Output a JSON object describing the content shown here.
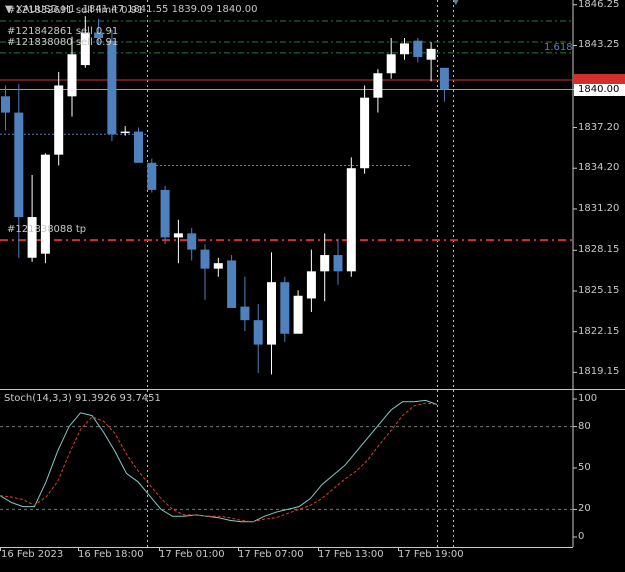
{
  "header": {
    "symbol_tf": "XAUUSD,H1",
    "ohlc": "1841.47 1841.55 1839.09 1840.00"
  },
  "orders": [
    {
      "label": "#121832691 sell limit 0.91",
      "price": 1845.05,
      "color": "#2e7d32"
    },
    {
      "label": "#121842861 sell 0.91",
      "price": 1843.5,
      "color": "#2e7d32"
    },
    {
      "label": "#121838080 sell 0.91",
      "price": 1842.7,
      "color": "#2e7d32"
    },
    {
      "label": "#121838088 tp",
      "price": 1828.9,
      "color": "#d32f2f"
    }
  ],
  "lines": {
    "red_solid_price": 1840.7,
    "bid_line_price": 1840.0,
    "blue_dotted_left_price": 1836.7,
    "blue_dotted_mid_price": 1834.4
  },
  "right_labels": {
    "lot_label": "1.618",
    "red_price_tag": "1840.70",
    "current_price_tag": "1840.00"
  },
  "price_axis": {
    "ticks": [
      "1846.25",
      "1843.25",
      "1840.00",
      "1837.20",
      "1834.20",
      "1831.20",
      "1828.15",
      "1825.15",
      "1822.15",
      "1819.15"
    ]
  },
  "oscillator": {
    "label": "Stoch(14,3,3) 91.3926 93.7451",
    "ticks": [
      "100",
      "80",
      "50",
      "20",
      "0"
    ],
    "levels": [
      80,
      20
    ]
  },
  "time_axis": {
    "labels": [
      "16 Feb 2023",
      "16 Feb 18:00",
      "17 Feb 01:00",
      "17 Feb 07:00",
      "17 Feb 13:00",
      "17 Feb 19:00"
    ]
  },
  "colors": {
    "bull": "#ffffff",
    "bear": "#4f81bd",
    "background": "#000000",
    "grid": "#888888",
    "main_line": "#80cbc4",
    "signal_line": "#e53935"
  },
  "chart_data": {
    "type": "candlestick",
    "ylim": [
      1818.0,
      1846.6
    ],
    "candles": [
      {
        "o": 1839.5,
        "h": 1840.3,
        "l": 1837.0,
        "c": 1838.3
      },
      {
        "o": 1838.3,
        "h": 1840.4,
        "l": 1827.6,
        "c": 1830.6
      },
      {
        "o": 1827.6,
        "h": 1833.7,
        "l": 1827.3,
        "c": 1830.6
      },
      {
        "o": 1827.9,
        "h": 1835.3,
        "l": 1827.2,
        "c": 1835.2
      },
      {
        "o": 1835.2,
        "h": 1841.3,
        "l": 1834.4,
        "c": 1840.3
      },
      {
        "o": 1839.5,
        "h": 1843.9,
        "l": 1838.0,
        "c": 1842.6
      },
      {
        "o": 1841.8,
        "h": 1845.4,
        "l": 1841.6,
        "c": 1844.2
      },
      {
        "o": 1844.2,
        "h": 1845.2,
        "l": 1843.3,
        "c": 1843.8
      },
      {
        "o": 1843.6,
        "h": 1844.4,
        "l": 1836.2,
        "c": 1836.7
      },
      {
        "o": 1836.9,
        "h": 1837.3,
        "l": 1836.6,
        "c": 1836.9
      },
      {
        "o": 1836.9,
        "h": 1837.2,
        "l": 1834.8,
        "c": 1834.6
      },
      {
        "o": 1834.6,
        "h": 1834.9,
        "l": 1832.4,
        "c": 1832.6
      },
      {
        "o": 1832.6,
        "h": 1832.9,
        "l": 1828.6,
        "c": 1829.1
      },
      {
        "o": 1829.1,
        "h": 1830.4,
        "l": 1827.2,
        "c": 1829.4
      },
      {
        "o": 1829.4,
        "h": 1829.8,
        "l": 1827.4,
        "c": 1828.2
      },
      {
        "o": 1828.2,
        "h": 1828.6,
        "l": 1824.5,
        "c": 1826.8
      },
      {
        "o": 1826.8,
        "h": 1827.6,
        "l": 1826.2,
        "c": 1827.2
      },
      {
        "o": 1827.4,
        "h": 1827.8,
        "l": 1824.4,
        "c": 1823.9
      },
      {
        "o": 1824.0,
        "h": 1826.2,
        "l": 1822.2,
        "c": 1823.0
      },
      {
        "o": 1823.0,
        "h": 1824.2,
        "l": 1819.1,
        "c": 1821.2
      },
      {
        "o": 1821.2,
        "h": 1828.0,
        "l": 1819.0,
        "c": 1825.8
      },
      {
        "o": 1825.8,
        "h": 1826.2,
        "l": 1821.4,
        "c": 1822.0
      },
      {
        "o": 1822.0,
        "h": 1825.2,
        "l": 1822.6,
        "c": 1824.8
      },
      {
        "o": 1824.6,
        "h": 1828.2,
        "l": 1823.6,
        "c": 1826.6
      },
      {
        "o": 1826.6,
        "h": 1829.4,
        "l": 1824.4,
        "c": 1827.8
      },
      {
        "o": 1827.8,
        "h": 1829.0,
        "l": 1825.6,
        "c": 1826.6
      },
      {
        "o": 1826.6,
        "h": 1835.0,
        "l": 1826.2,
        "c": 1834.2
      },
      {
        "o": 1834.2,
        "h": 1840.3,
        "l": 1833.8,
        "c": 1839.4
      },
      {
        "o": 1839.4,
        "h": 1841.5,
        "l": 1838.3,
        "c": 1841.2
      },
      {
        "o": 1841.2,
        "h": 1843.8,
        "l": 1840.8,
        "c": 1842.6
      },
      {
        "o": 1842.6,
        "h": 1843.8,
        "l": 1842.2,
        "c": 1843.4
      },
      {
        "o": 1843.6,
        "h": 1843.8,
        "l": 1842.0,
        "c": 1842.4
      },
      {
        "o": 1842.2,
        "h": 1843.5,
        "l": 1840.6,
        "c": 1843.0
      },
      {
        "o": 1841.6,
        "h": 1841.6,
        "l": 1839.1,
        "c": 1840.0
      }
    ],
    "stoch_main": [
      30,
      25,
      22,
      22,
      40,
      62,
      80,
      90,
      88,
      76,
      62,
      46,
      40,
      30,
      20,
      15,
      15,
      16,
      15,
      14,
      12,
      11,
      11,
      15,
      18,
      20,
      22,
      28,
      38,
      45,
      52,
      62,
      72,
      82,
      92,
      98,
      98,
      99,
      96
    ],
    "stoch_signal": [
      30,
      29,
      27,
      23,
      29,
      40,
      60,
      78,
      87,
      84,
      75,
      60,
      48,
      38,
      28,
      20,
      16,
      16,
      15,
      15,
      14,
      12,
      11,
      13,
      14,
      17,
      20,
      23,
      28,
      35,
      42,
      48,
      56,
      67,
      77,
      88,
      95,
      97,
      96
    ]
  }
}
